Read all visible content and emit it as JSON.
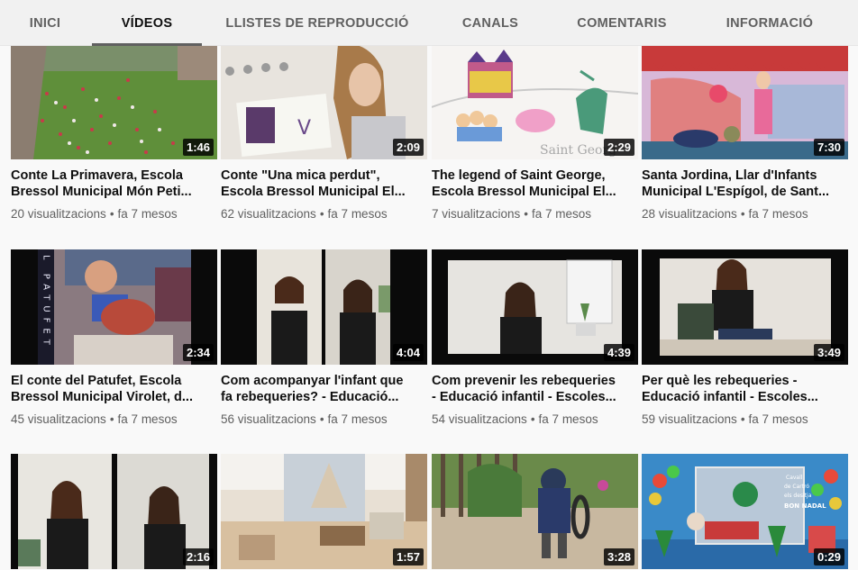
{
  "tabs": [
    {
      "label": "INICI"
    },
    {
      "label": "VÍDEOS"
    },
    {
      "label": "LLISTES DE REPRODUCCIÓ"
    },
    {
      "label": "CANALS"
    },
    {
      "label": "COMENTARIS"
    },
    {
      "label": "INFORMACIÓ"
    }
  ],
  "active_tab": "VÍDEOS",
  "videos": [
    {
      "duration": "1:46",
      "title_line1": "Conte La Primavera, Escola",
      "title_line2": "Bressol Municipal Món Peti...",
      "views": "20 visualitzacions",
      "age": "fa 7 mesos"
    },
    {
      "duration": "2:09",
      "title_line1": "Conte \"Una mica perdut\",",
      "title_line2": "Escola Bressol Municipal El...",
      "views": "62 visualitzacions",
      "age": "fa 7 mesos"
    },
    {
      "duration": "2:29",
      "title_line1": "The legend of Saint George,",
      "title_line2": "Escola Bressol Municipal El...",
      "views": "7 visualitzacions",
      "age": "fa 7 mesos"
    },
    {
      "duration": "7:30",
      "title_line1": "Santa Jordina, Llar d'Infants",
      "title_line2": "Municipal L'Espígol, de Sant...",
      "views": "28 visualitzacions",
      "age": "fa 7 mesos"
    },
    {
      "duration": "2:34",
      "title_line1": "El conte del Patufet, Escola",
      "title_line2": "Bressol Municipal Virolet, d...",
      "views": "45 visualitzacions",
      "age": "fa 7 mesos"
    },
    {
      "duration": "4:04",
      "title_line1": "Com acompanyar l'infant que",
      "title_line2": "fa rebequeries? - Educació...",
      "views": "56 visualitzacions",
      "age": "fa 7 mesos"
    },
    {
      "duration": "4:39",
      "title_line1": "Com prevenir les rebequeries",
      "title_line2": "- Educació infantil - Escoles...",
      "views": "54 visualitzacions",
      "age": "fa 7 mesos"
    },
    {
      "duration": "3:49",
      "title_line1": "Per què les rebequeries -",
      "title_line2": "Educació infantil - Escoles...",
      "views": "59 visualitzacions",
      "age": "fa 7 mesos"
    },
    {
      "duration": "2:16"
    },
    {
      "duration": "1:57"
    },
    {
      "duration": "3:28"
    },
    {
      "duration": "0:29"
    }
  ],
  "thumb_text": {
    "patufet_vertical": "L PATUFET",
    "greeting": [
      "Cavall",
      "de Cartró",
      "els desitja",
      "BON NADAL"
    ]
  },
  "icons": {
    "separator": "•"
  },
  "colors": {
    "tab_bg": "#f1f1f1",
    "page_bg": "#f9f9f9",
    "duration_bg": "#000000"
  }
}
